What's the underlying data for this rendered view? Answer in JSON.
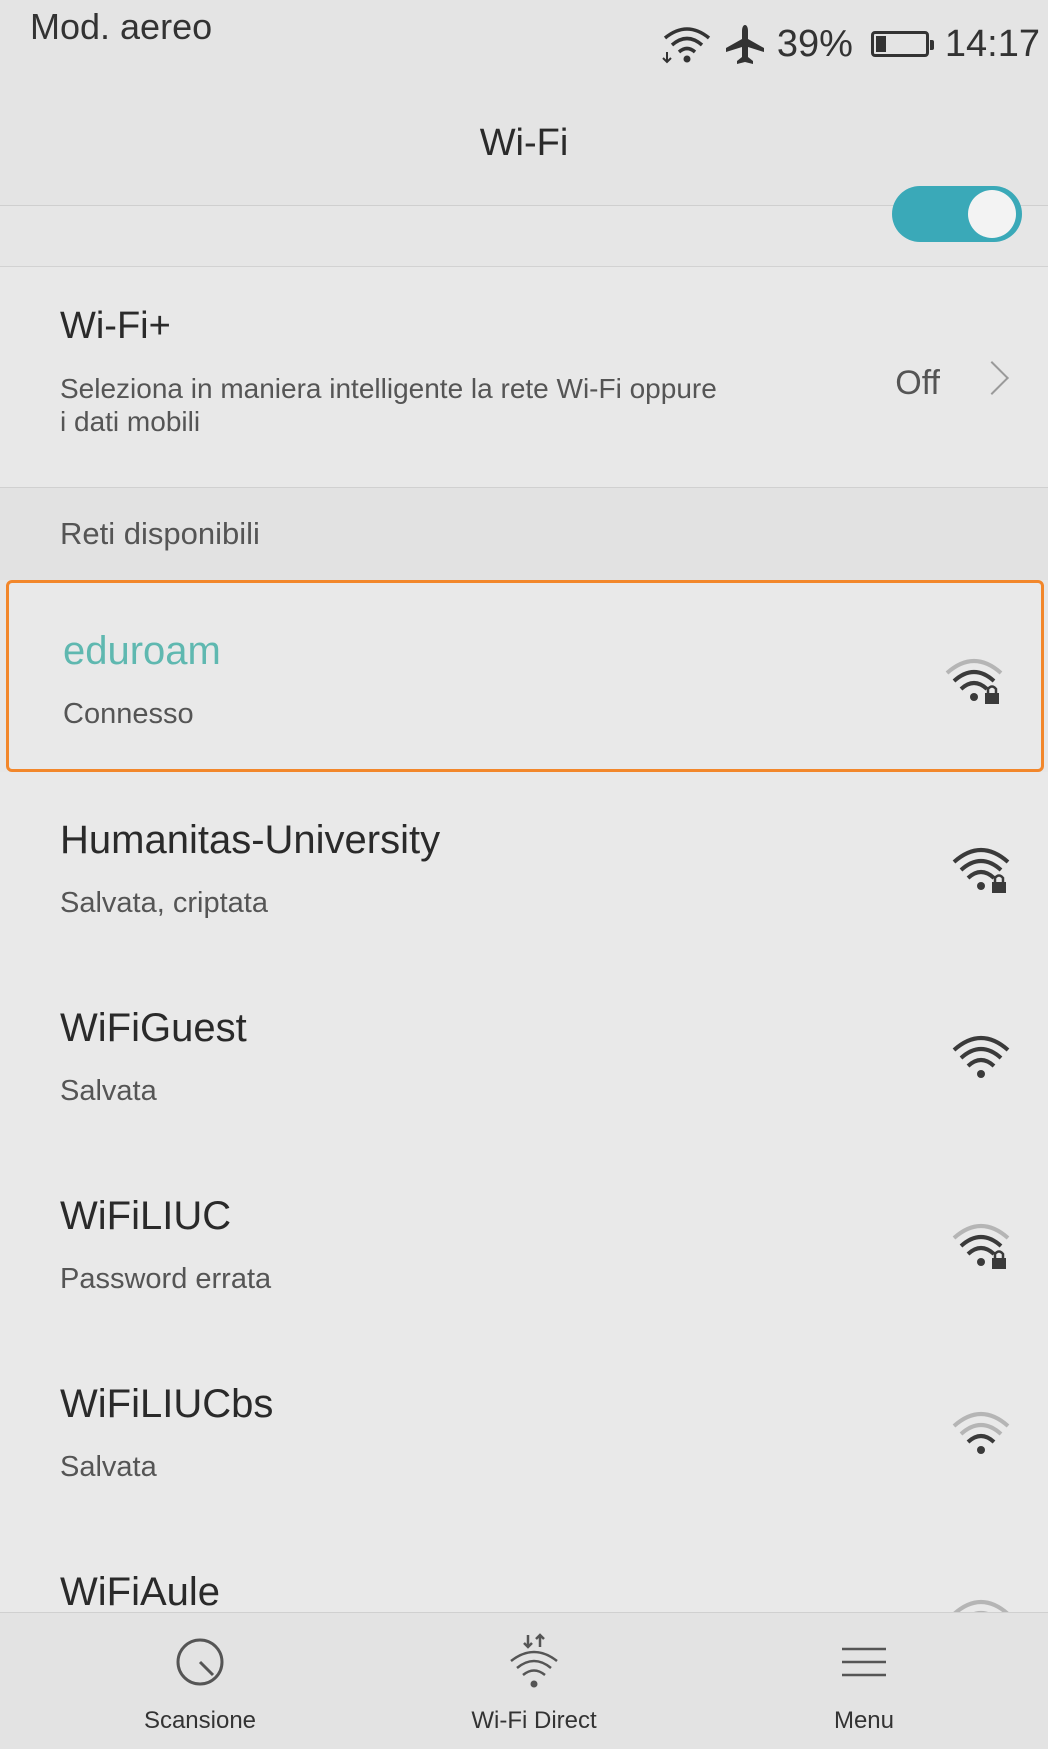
{
  "status_bar": {
    "mode_label": "Mod. aereo",
    "battery_percent": "39%",
    "battery_level": 0.39,
    "time": "14:17",
    "icons": [
      "wifi-icon",
      "airplane-icon",
      "battery-icon"
    ]
  },
  "header": {
    "title": "Wi-Fi",
    "wifi_toggle_on": true
  },
  "wifi_plus": {
    "title": "Wi-Fi+",
    "description": "Seleziona in maniera intelligente la rete Wi-Fi oppure i dati mobili",
    "value": "Off"
  },
  "available_networks": {
    "label": "Reti disponibili",
    "items": [
      {
        "name": "eduroam",
        "status": "Connesso",
        "secured": true,
        "signal": 3,
        "connected": true
      },
      {
        "name": "Humanitas-University",
        "status": "Salvata, criptata",
        "secured": true,
        "signal": 4,
        "connected": false
      },
      {
        "name": "WiFiGuest",
        "status": "Salvata",
        "secured": false,
        "signal": 4,
        "connected": false
      },
      {
        "name": "WiFiLIUC",
        "status": "Password errata",
        "secured": true,
        "signal": 3,
        "connected": false
      },
      {
        "name": "WiFiLIUCbs",
        "status": "Salvata",
        "secured": false,
        "signal": 2,
        "connected": false
      },
      {
        "name": "WiFiAule",
        "status": "",
        "secured": false,
        "signal": 2,
        "connected": false
      }
    ]
  },
  "bottom_bar": {
    "scan_label": "Scansione",
    "direct_label": "Wi-Fi Direct",
    "menu_label": "Menu"
  },
  "colors": {
    "accent": "#3aa9b8",
    "connected_text": "#5fb8b0",
    "highlight_border": "#f2872b"
  }
}
